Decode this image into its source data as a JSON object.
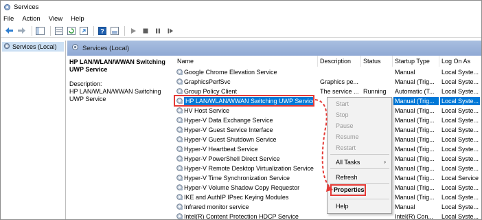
{
  "window": {
    "title": "Services",
    "menu": [
      "File",
      "Action",
      "View",
      "Help"
    ]
  },
  "tree": {
    "item": "Services (Local)"
  },
  "pane": {
    "header": "Services (Local)"
  },
  "description": {
    "title_line1": "HP LAN/WLAN/WWAN Switching",
    "title_line2": "UWP Service",
    "label": "Description:",
    "text_line1": "HP LAN/WLAN/WWAN Switching",
    "text_line2": "UWP Service"
  },
  "columns": {
    "name": "Name",
    "description": "Description",
    "status": "Status",
    "startup": "Startup Type",
    "logon": "Log On As"
  },
  "services": [
    {
      "name": "Google Chrome Elevation Service",
      "description": "",
      "status": "",
      "startup": "Manual",
      "logon": "Local Syste..."
    },
    {
      "name": "GraphicsPerfSvc",
      "description": "Graphics pe...",
      "status": "",
      "startup": "Manual (Trig...",
      "logon": "Local Syste..."
    },
    {
      "name": "Group Policy Client",
      "description": "The service ...",
      "status": "Running",
      "startup": "Automatic (T...",
      "logon": "Local Syste..."
    },
    {
      "name": "HP LAN/WLAN/WWAN Switching UWP Service",
      "description": "",
      "status": "",
      "startup": "Manual (Trig...",
      "logon": "Local Syste...",
      "selected": true
    },
    {
      "name": "HV Host Service",
      "description": "",
      "status": "",
      "startup": "Manual (Trig...",
      "logon": "Local Syste..."
    },
    {
      "name": "Hyper-V Data Exchange Service",
      "description": "",
      "status": "",
      "startup": "Manual (Trig...",
      "logon": "Local Syste..."
    },
    {
      "name": "Hyper-V Guest Service Interface",
      "description": "",
      "status": "",
      "startup": "Manual (Trig...",
      "logon": "Local Syste..."
    },
    {
      "name": "Hyper-V Guest Shutdown Service",
      "description": "",
      "status": "",
      "startup": "Manual (Trig...",
      "logon": "Local Syste..."
    },
    {
      "name": "Hyper-V Heartbeat Service",
      "description": "",
      "status": "",
      "startup": "Manual (Trig...",
      "logon": "Local Syste..."
    },
    {
      "name": "Hyper-V PowerShell Direct Service",
      "description": "",
      "status": "",
      "startup": "Manual (Trig...",
      "logon": "Local Syste..."
    },
    {
      "name": "Hyper-V Remote Desktop Virtualization Service",
      "description": "",
      "status": "",
      "startup": "Manual (Trig...",
      "logon": "Local Syste..."
    },
    {
      "name": "Hyper-V Time Synchronization Service",
      "description": "",
      "status": "",
      "startup": "Manual (Trig...",
      "logon": "Local Service"
    },
    {
      "name": "Hyper-V Volume Shadow Copy Requestor",
      "description": "",
      "status": "",
      "startup": "Manual (Trig...",
      "logon": "Local Syste..."
    },
    {
      "name": "IKE and AuthIP IPsec Keying Modules",
      "description": "",
      "status": "",
      "startup": "Manual (Trig...",
      "logon": "Local Syste..."
    },
    {
      "name": "Infrared monitor service",
      "description": "",
      "status": "",
      "startup": "Manual",
      "logon": "Local Syste..."
    },
    {
      "name": "Intel(R) Content Protection HDCP Service",
      "description": "",
      "status": "",
      "startup": "Intel(R) Con...",
      "logon": "Local Syste..."
    }
  ],
  "context_menu": {
    "start": "Start",
    "stop": "Stop",
    "pause": "Pause",
    "resume": "Resume",
    "restart": "Restart",
    "all_tasks": "All Tasks",
    "refresh": "Refresh",
    "properties": "Properties",
    "help": "Help"
  },
  "colors": {
    "selection": "#0078d7",
    "callout": "#e53935",
    "pane_header": "#a9bfe0"
  }
}
